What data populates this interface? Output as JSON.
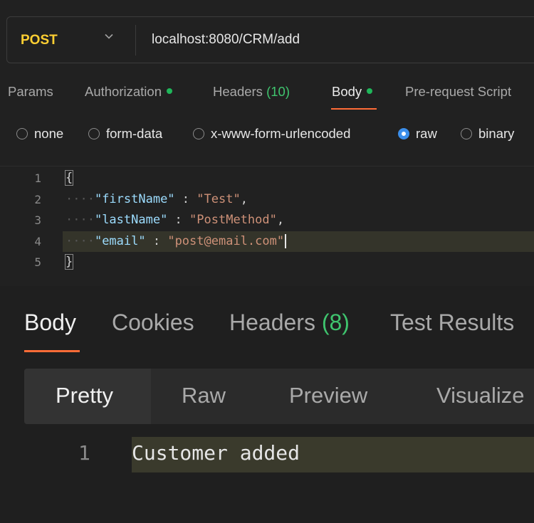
{
  "request": {
    "method": "POST",
    "url": "localhost:8080/CRM/add"
  },
  "tabs": [
    {
      "label": "Params"
    },
    {
      "label": "Authorization"
    },
    {
      "label": "Headers",
      "count": "(10)"
    },
    {
      "label": "Body"
    },
    {
      "label": "Pre-request Script"
    }
  ],
  "body_types": [
    {
      "label": "none",
      "selected": false
    },
    {
      "label": "form-data",
      "selected": false
    },
    {
      "label": "x-www-form-urlencoded",
      "selected": false
    },
    {
      "label": "raw",
      "selected": true
    },
    {
      "label": "binary",
      "selected": false
    }
  ],
  "editor": {
    "line_numbers": [
      "1",
      "2",
      "3",
      "4",
      "5"
    ],
    "open_brace": "{",
    "close_brace": "}",
    "fields": [
      {
        "key": "\"firstName\"",
        "sep": " : ",
        "value": "\"Test\"",
        "comma": ","
      },
      {
        "key": "\"lastName\"",
        "sep": " : ",
        "value": "\"PostMethod\"",
        "comma": ","
      },
      {
        "key": "\"email\"",
        "sep": " : ",
        "value": "\"post@email.com\"",
        "comma": ""
      }
    ]
  },
  "response": {
    "tabs": [
      {
        "label": "Body"
      },
      {
        "label": "Cookies"
      },
      {
        "label": "Headers",
        "count": "(8)"
      },
      {
        "label": "Test Results"
      }
    ],
    "views": [
      "Pretty",
      "Raw",
      "Preview",
      "Visualize"
    ],
    "line_number": "1",
    "text": "Customer added"
  },
  "colors": {
    "method": "#ffcf32",
    "accent": "#ff6c37",
    "status_dot": "#1fb65a",
    "radio_selected": "#3b8eea"
  }
}
